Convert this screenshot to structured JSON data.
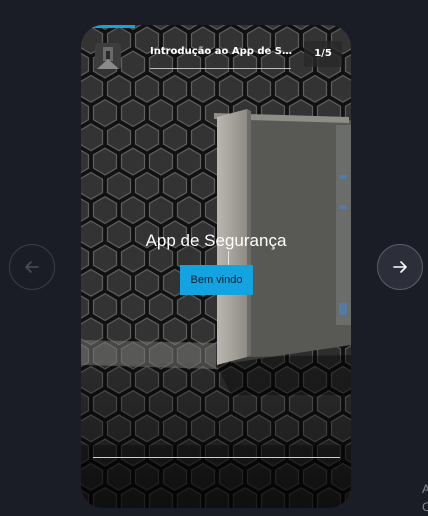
{
  "story": {
    "title": "Introdução ao App de Seg...",
    "counter": "1/5",
    "heading": "App de Segurança",
    "cta_label": "Bem vindo",
    "progress_fraction": 0.2
  },
  "corner_text": [
    "A",
    "C"
  ],
  "colors": {
    "page_background": "#1b1d26",
    "accent": "#14a3e0",
    "button_text": "#0c1c2c"
  },
  "icons": {
    "previous": "arrow-left-icon",
    "next": "arrow-right-icon"
  }
}
